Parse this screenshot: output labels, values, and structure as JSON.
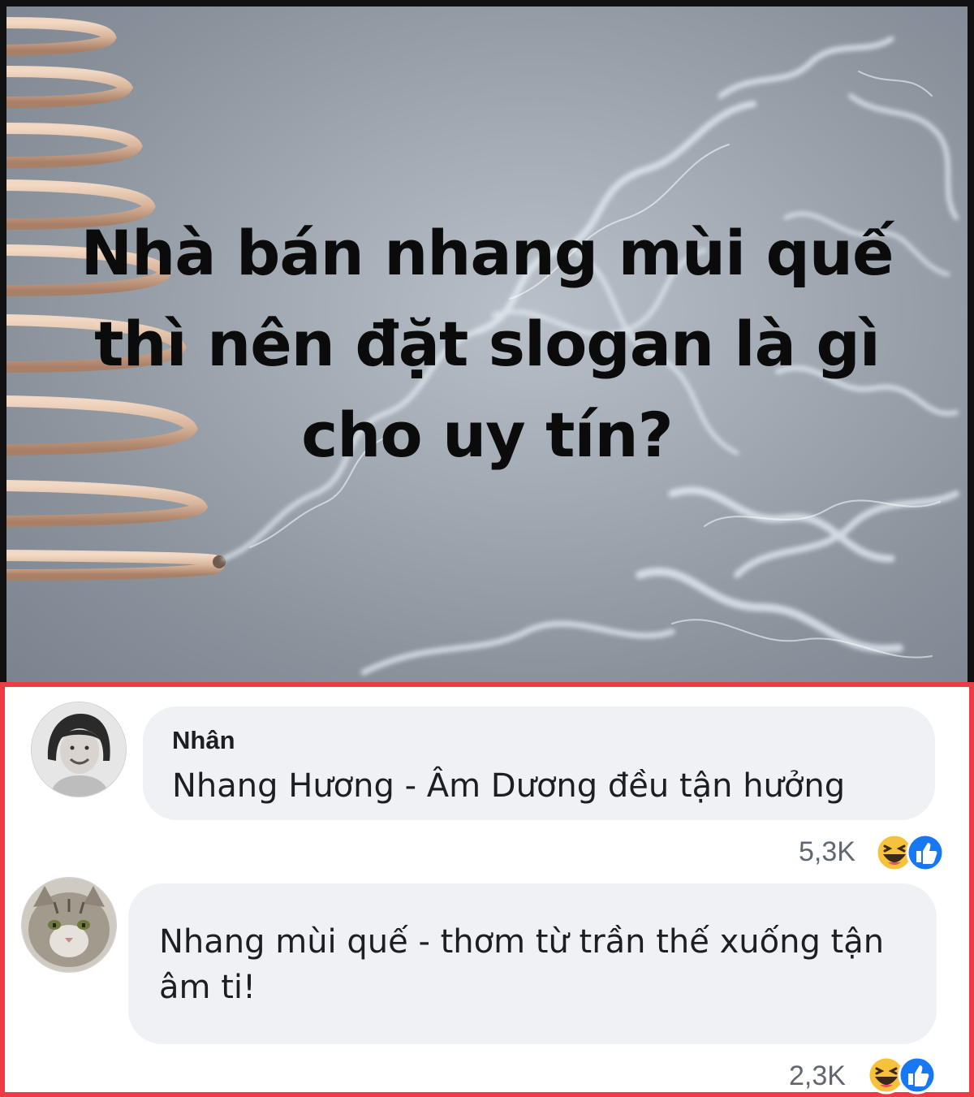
{
  "post": {
    "headline_lines": [
      "Nhà bán nhang mùi quế",
      "thì nên đặt slogan là gì",
      "cho uy tín?"
    ]
  },
  "comments": [
    {
      "author": "Nhân",
      "text": "Nhang Hương - Âm Dương đều tận hưởng",
      "reaction_count": "5,3K",
      "reaction_icons": [
        "haha-icon",
        "like-icon"
      ]
    },
    {
      "author": "",
      "text_lines": [
        "Nhang mùi quế - thơm từ trần thế xuống tận",
        "âm ti!"
      ],
      "reaction_count": "2,3K",
      "reaction_icons": [
        "haha-icon",
        "like-icon"
      ]
    }
  ],
  "colors": {
    "frame_border": "#ef3b45",
    "bubble": "#eff1f4",
    "like_blue": "#1877f2",
    "haha_yellow": "#f7c23b"
  }
}
